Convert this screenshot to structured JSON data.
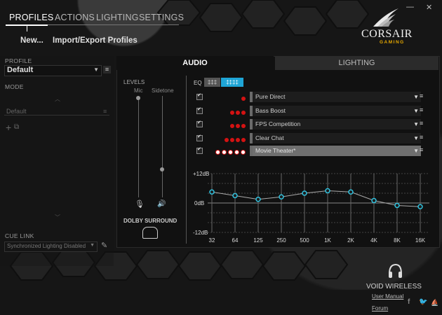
{
  "nav": {
    "tabs": [
      "PROFILES",
      "ACTIONS",
      "LIGHTING",
      "SETTINGS"
    ],
    "active": 0
  },
  "links": {
    "new": "New...",
    "import_export": "Import/Export Profiles"
  },
  "brand": {
    "name": "CORSAIR",
    "sub": "GAMING"
  },
  "window": {
    "minimize": "—",
    "close": "✕"
  },
  "left": {
    "profile_label": "PROFILE",
    "profile_value": "Default",
    "mode_label": "MODE",
    "mode_item": "Default",
    "cue_link_label": "CUE LINK",
    "cue_link_value": "Synchronized Lighting Disabled"
  },
  "panel": {
    "tab_audio": "AUDIO",
    "tab_lighting": "LIGHTING",
    "levels_label": "LEVELS",
    "mic_label": "Mic",
    "sidetone_label": "Sidetone",
    "dolby_label": "DOLBY SURROUND",
    "eq_label": "EQ",
    "presets": [
      {
        "name": "Pure Direct",
        "dots": 1,
        "ring": false
      },
      {
        "name": "Bass Boost",
        "dots": 3,
        "ring": false
      },
      {
        "name": "FPS Competition",
        "dots": 3,
        "ring": false
      },
      {
        "name": "Clear Chat",
        "dots": 4,
        "ring": false
      },
      {
        "name": "Movie Theater*",
        "dots": 5,
        "ring": true
      }
    ],
    "eq_scale": {
      "top": "+12dB",
      "mid": "0dB",
      "bottom": "-12dB"
    },
    "eq_freqs": [
      "32",
      "64",
      "125",
      "250",
      "500",
      "1K",
      "2K",
      "4K",
      "8K",
      "16K"
    ],
    "eq_values_db": [
      4.5,
      3,
      1.5,
      2.5,
      4,
      5,
      4.5,
      1,
      -1,
      -1.5
    ]
  },
  "device": {
    "name": "VOID WIRELESS"
  },
  "footer": {
    "manual": "User Manual",
    "forum": "Forum"
  }
}
